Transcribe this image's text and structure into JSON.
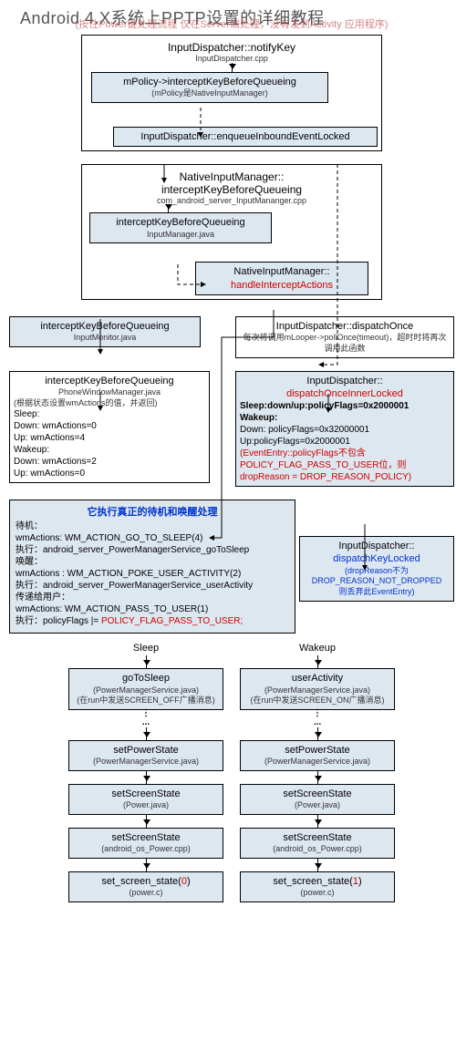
{
  "title": "Android 4.X系统上PPTP设置的详细教程",
  "subtitle_faded": "(按住Power键处理流程  仅在Server端处理，没有发到Activity 应用程序)",
  "b1": {
    "t": "InputDispatcher::notifyKey",
    "s": "InputDispatcher.cpp"
  },
  "b2": {
    "t": "mPolicy->interceptKeyBeforeQueueing",
    "s": "(mPolicy是NativeInputManager)"
  },
  "b3": {
    "t": "InputDispatcher::enqueueInboundEventLocked"
  },
  "b4": {
    "t": "NativeInputManager::",
    "t2": "interceptKeyBeforeQueueing",
    "s": "com_android_server_InputMananger.cpp"
  },
  "b5": {
    "t": "interceptKeyBeforeQueueing",
    "s": "InputManager.java"
  },
  "b6": {
    "t": "NativeInputManager::",
    "t2": "handleInterceptActions"
  },
  "b7": {
    "t": "interceptKeyBeforeQueueing",
    "s": "InputMonitor.java"
  },
  "b8": {
    "t": "InputDispatcher::dispatchOnce",
    "s": "每次将调用mLooper->pollOnce(timeout)，超时时将再次调用此函数"
  },
  "b9": {
    "t": "interceptKeyBeforeQueueing",
    "s": "PhoneWindowManager.java",
    "note": "(根据状态设置wmActions的值，并返回)",
    "lines": [
      "Sleep:",
      "Down: wmActions=0",
      "Up:     wmActions=4",
      "Wakeup:",
      "Down: wmActions=2",
      "Up:     wmActions=0"
    ]
  },
  "b10": {
    "t": "InputDispatcher::",
    "t2": "dispatchOnceInnerLocked",
    "l1": "Sleep:down/up:policyFlags=0x2000001",
    "l2": "Wakeup:",
    "l3": "Down: policyFlags=0x32000001",
    "l4": "Up:policyFlags=0x2000001",
    "l5": "(EventEntry::policyFlags不包含",
    "l6": "POLICY_FLAG_PASS_TO_USER位，则",
    "l7": "dropReason = DROP_REASON_POLICY)"
  },
  "b11": {
    "title": "它执行真正的待机和唤醒处理",
    "lines": [
      "待机：",
      "wmActions: WM_ACTION_GO_TO_SLEEP(4)",
      "执行：android_server_PowerManagerService_goToSleep",
      "唤醒：",
      "wmActions : WM_ACTION_POKE_USER_ACTIVITY(2)",
      "执行：android_server_PowerManagerService_userActivity",
      "传递给用户：",
      "wmActions: WM_ACTION_PASS_TO_USER(1)"
    ],
    "last_prefix": "执行：policyFlags |= ",
    "last_red": "POLICY_FLAG_PASS_TO_USER;"
  },
  "b12": {
    "t": "InputDispatcher::",
    "t2": "dispatchKeyLocked",
    "l1": "(dropReason不为",
    "l2": "DROP_REASON_NOT_DROPPED",
    "l3": "则丢弃此EventEntry)"
  },
  "branch_sleep": "Sleep",
  "branch_wake": "Wakeup",
  "sleep_chain": [
    {
      "t": "goToSleep",
      "s": "(PowerManagerService.java)",
      "n": "(在run中发送SCREEN_OFF广播消息)"
    },
    {
      "t": "setPowerState",
      "s": "(PowerManagerService.java)"
    },
    {
      "t": "setScreenState",
      "s": "(Power.java)"
    },
    {
      "t": "setScreenState",
      "s": "(android_os_Power.cpp)"
    },
    {
      "t": "set_screen_state(",
      "arg": "0",
      "tail": ")",
      "s": "(power.c)"
    }
  ],
  "wake_chain": [
    {
      "t": "userActivity",
      "s": "(PowerManagerService.java)",
      "n": "(在run中发送SCREEN_ON广播消息)"
    },
    {
      "t": "setPowerState",
      "s": "(PowerManagerService.java)"
    },
    {
      "t": "setScreenState",
      "s": "(Power.java)"
    },
    {
      "t": "setScreenState",
      "s": "(android_os_Power.cpp)"
    },
    {
      "t": "set_screen_state(",
      "arg": "1",
      "tail": ")",
      "s": "(power.c)"
    }
  ]
}
